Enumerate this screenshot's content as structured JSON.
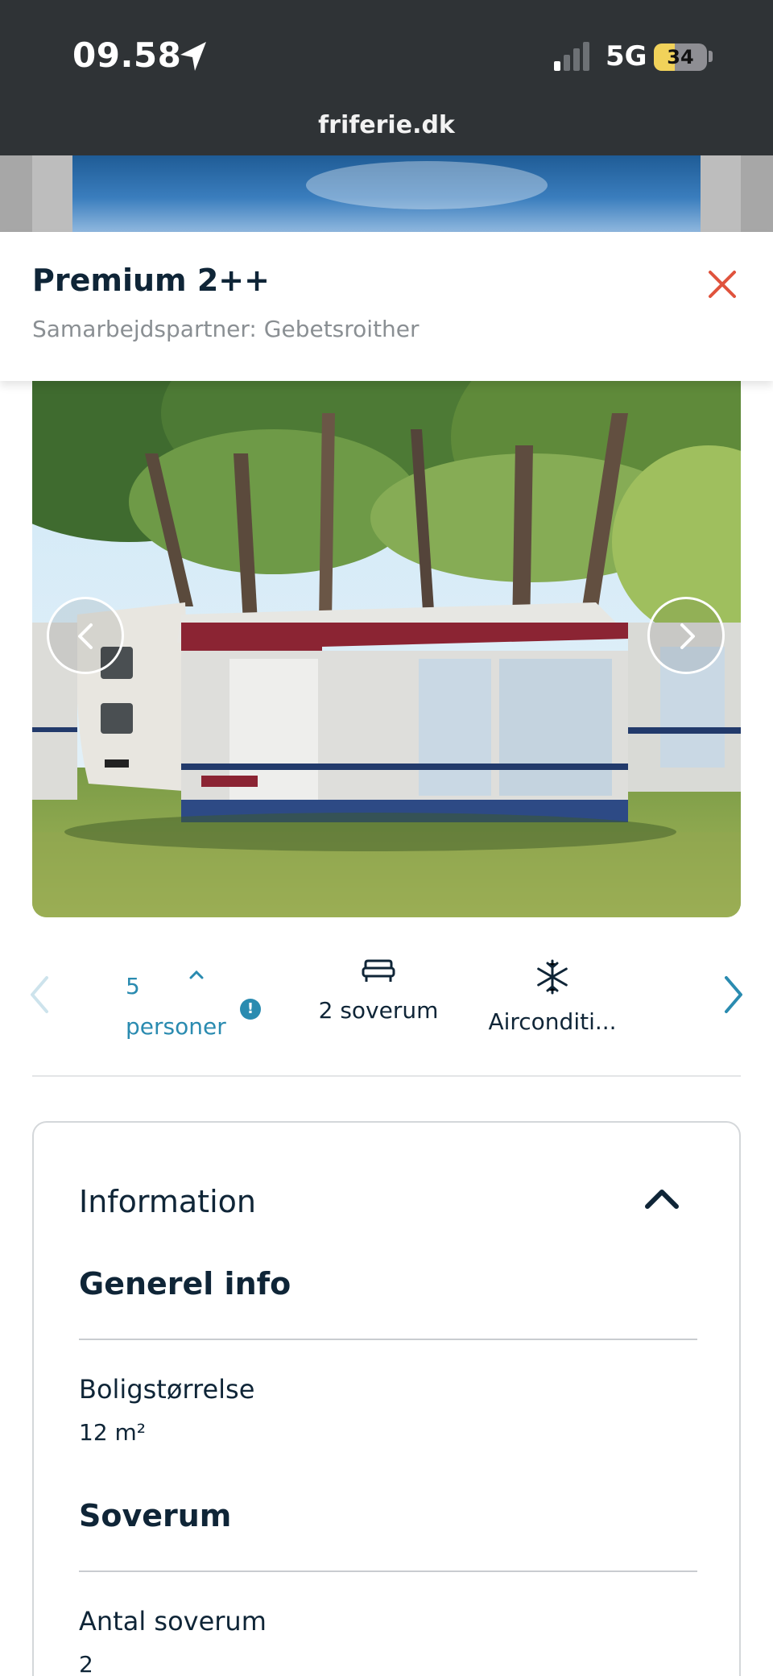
{
  "status_bar": {
    "time": "09.58",
    "network": "5G",
    "battery": "34"
  },
  "browser": {
    "url": "friferie.dk"
  },
  "modal": {
    "title": "Premium 2++",
    "subtitle": "Samarbejdspartner: Gebetsroither",
    "close_icon": "close-icon"
  },
  "amenities": {
    "items": [
      {
        "value": "5",
        "label": "personer",
        "icon": "info-icon"
      },
      {
        "label": "2 soverum",
        "icon": "bed-icon"
      },
      {
        "label": "Airconditi...",
        "icon": "snowflake-icon"
      }
    ]
  },
  "information": {
    "title": "Information",
    "sections": [
      {
        "heading": "Generel info",
        "fields": [
          {
            "label": "Boligstørrelse",
            "value": "12 m²"
          }
        ]
      },
      {
        "heading": "Soverum",
        "fields": [
          {
            "label": "Antal soverum",
            "value": "2"
          }
        ]
      }
    ]
  },
  "colors": {
    "primary_text": "#0f2537",
    "accent": "#2a8bb0",
    "close": "#e0533d",
    "status_bar": "#2f3336"
  }
}
